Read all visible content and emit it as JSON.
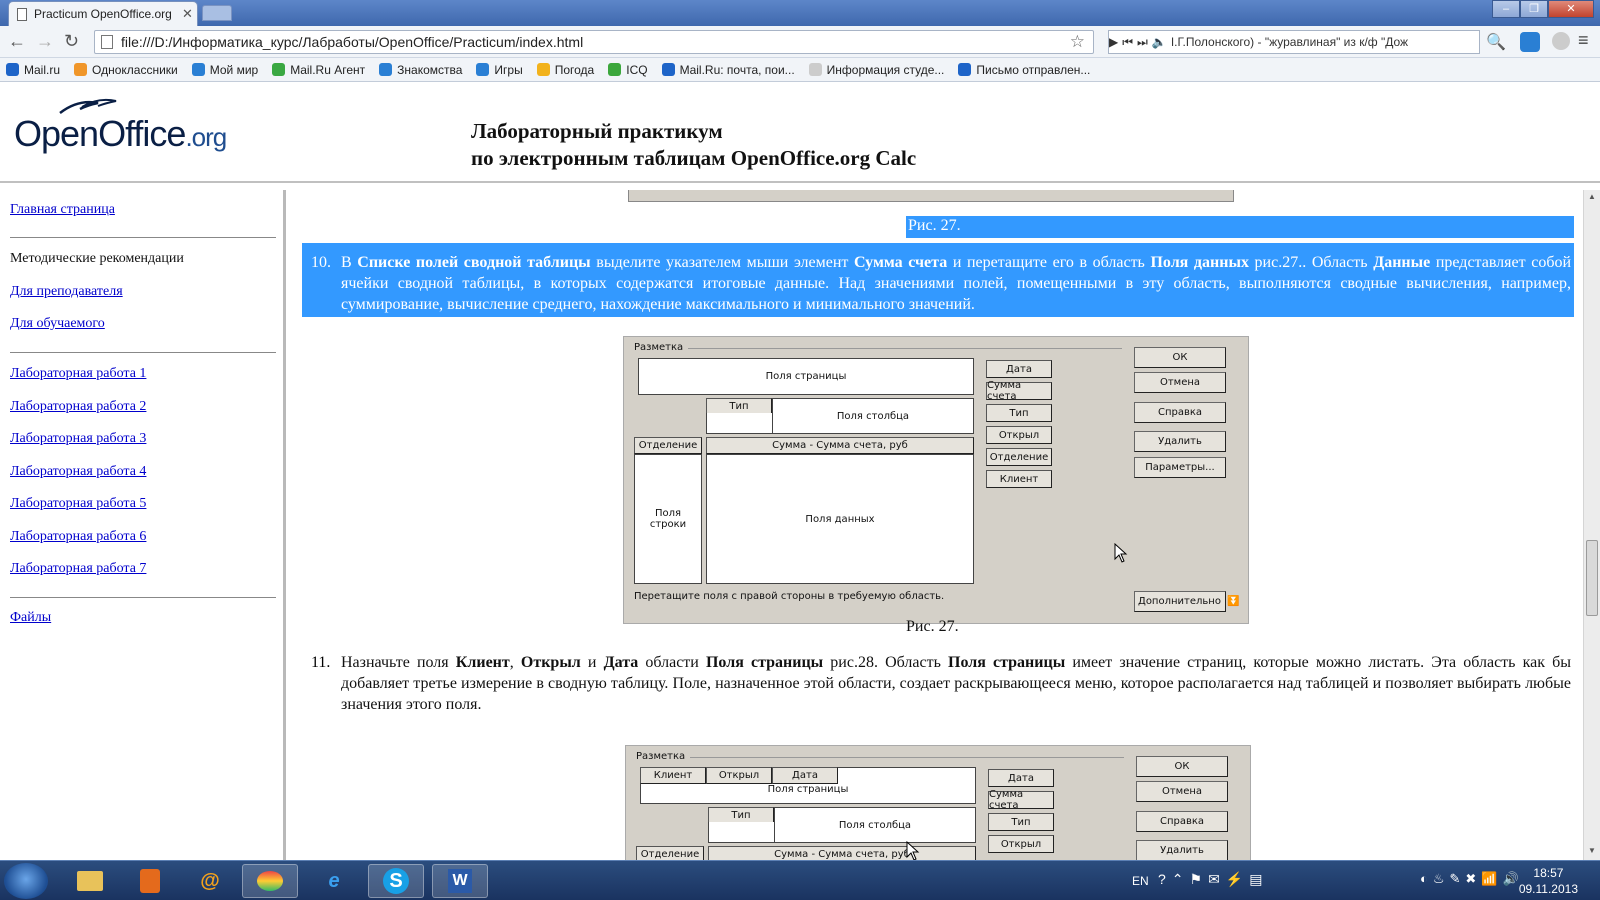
{
  "browser": {
    "tab_title": "Practicum OpenOffice.org",
    "tab_close": "✕",
    "address": "file:///D:/Информатика_курс/Лабработы/OpenOffice/Practicum/index.html",
    "media_text": "I.Г.Полонского) - \"журавлиная\" из к/ф \"Дож",
    "bookmarks": [
      {
        "label": "Mail.ru",
        "color": "#1e64c8"
      },
      {
        "label": "Одноклассники",
        "color": "#f0962a"
      },
      {
        "label": "Мой мир",
        "color": "#2a7fd4"
      },
      {
        "label": "Mail.Ru Агент",
        "color": "#3aa842"
      },
      {
        "label": "Знакомства",
        "color": "#2a7fd4"
      },
      {
        "label": "Игры",
        "color": "#2a7fd4"
      },
      {
        "label": "Погода",
        "color": "#f2b21c"
      },
      {
        "label": "ICQ",
        "color": "#3ca73c"
      },
      {
        "label": "Mail.Ru: почта, пои...",
        "color": "#1e64c8"
      },
      {
        "label": "Информация студе...",
        "color": "#cccccc"
      },
      {
        "label": "Письмо отправлен...",
        "color": "#1e64c8"
      }
    ]
  },
  "header": {
    "logo_main": "OpenOffice",
    "logo_org": ".org",
    "title_line1": "Лабораторный практикум",
    "title_line2": "по электронным таблицам OpenOffice.org Calc"
  },
  "sidebar": {
    "home": "Главная страница",
    "methodical": "Методические рекомендации",
    "for_teacher": "Для преподавателя",
    "for_student": "Для обучаемого",
    "labs": [
      "Лабораторная работа 1",
      "Лабораторная работа 2",
      "Лабораторная работа 3",
      "Лабораторная работа 4",
      "Лабораторная работа 5",
      "Лабораторная работа 6",
      "Лабораторная работа 7"
    ],
    "files": "Файлы"
  },
  "content": {
    "caption_top": "Рис. 27.",
    "step10_num": "10.",
    "step10": {
      "t1": "В ",
      "b1": "Списке полей сводной таблицы",
      "t2": " выделите указателем мыши элемент ",
      "b2": "Сумма счета",
      "t3": " и перетащите его в область ",
      "b3": "Поля данных",
      "t4": " рис.27.. Область ",
      "b4": "Данные",
      "t5": " представляет собой ячейки сводной таблицы, в которых содержатся итоговые данные. Над значениями полей, помещенными в эту область, выполняются сводные вычисления, например, суммирование, вычисление среднего, нахождение максимального и минимального значений."
    },
    "caption_mid": "Рис. 27.",
    "step11_num": "11.",
    "step11": {
      "t1": "Назначьте поля ",
      "b1": "Клиент",
      "t2": ", ",
      "b2": "Открыл",
      "t3": " и ",
      "b3": "Дата",
      "t4": " области ",
      "b4": "Поля страницы",
      "t5": " рис.28. Область ",
      "b5": "Поля страницы",
      "t6": " имеет значение страниц, которые можно листать. Эта область как бы добавляет третье измерение в сводную таблицу. Поле, назначенное этой области, создает раскрывающееся меню, которое располагается над таблицей и позволяет выбирать любые значения этого поля."
    }
  },
  "dialog1": {
    "group": "Разметка",
    "page_fields": "Поля страницы",
    "col_fields": "Поля столбца",
    "tip": "Тип",
    "row_label": "Отделение",
    "data_label": "Сумма -  Сумма счета, руб",
    "row_fields": "Поля строки",
    "data_fields": "Поля данных",
    "field_buttons": [
      "Дата",
      "Сумма счета",
      "Тип",
      "Открыл",
      "Отделение",
      "Клиент"
    ],
    "ok": "ОК",
    "cancel": "Отмена",
    "help": "Справка",
    "delete": "Удалить",
    "params": "Параметры...",
    "hint": "Перетащите поля с правой стороны в требуемую область.",
    "more": "Дополнительно"
  },
  "dialog2": {
    "group": "Разметка",
    "page_tags": [
      "Клиент",
      "Открыл",
      "Дата"
    ],
    "page_fields": "Поля страницы",
    "tip": "Тип",
    "col_fields": "Поля столбца",
    "row_label": "Отделение",
    "data_label": "Сумма -  Сумма счета, руб",
    "field_buttons": [
      "Дата",
      "Сумма счета",
      "Тип",
      "Открыл"
    ],
    "ok": "ОК",
    "cancel": "Отмена",
    "help": "Справка",
    "delete": "Удалить"
  },
  "taskbar": {
    "lang": "EN",
    "time": "18:57",
    "date": "09.11.2013"
  }
}
